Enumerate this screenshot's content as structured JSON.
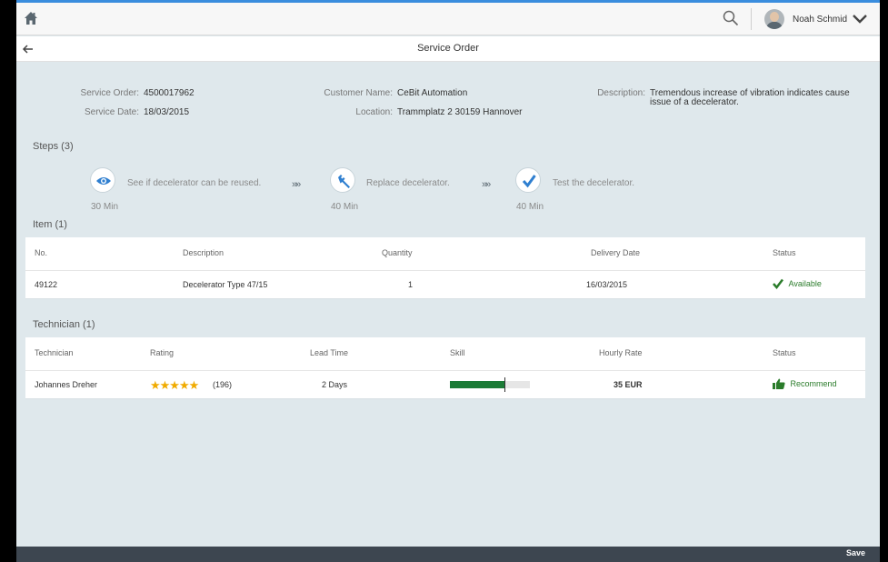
{
  "shell": {
    "user_name": "Noah Schmid"
  },
  "page": {
    "title": "Service Order"
  },
  "header": {
    "service_order_label": "Service Order:",
    "service_order_value": "4500017962",
    "service_date_label": "Service Date:",
    "service_date_value": "18/03/2015",
    "customer_name_label": "Customer Name:",
    "customer_name_value": "CeBit Automation",
    "location_label": "Location:",
    "location_value": "Trammplatz 2 30159 Hannover",
    "description_label": "Description:",
    "description_value_line1": "Tremendous increase of vibration indicates cause",
    "description_value_line2": "issue of a decelerator."
  },
  "steps": {
    "title": "Steps (3)",
    "items": [
      {
        "label": "See if decelerator can be reused.",
        "time": "30 Min",
        "icon": "eye-icon"
      },
      {
        "label": "Replace decelerator.",
        "time": "40 Min",
        "icon": "wrench-icon"
      },
      {
        "label": "Test the decelerator.",
        "time": "40 Min",
        "icon": "checkmark-icon"
      }
    ],
    "arrow": "»»"
  },
  "items_table": {
    "title": "Item (1)",
    "headers": [
      "No.",
      "Description",
      "Quantity",
      "Delivery Date",
      "Status"
    ],
    "rows": [
      {
        "no": "49122",
        "description": "Decelerator Type 47/15",
        "quantity": "1",
        "delivery_date": "16/03/2015",
        "status": "Available"
      }
    ]
  },
  "technician_table": {
    "title": "Technician (1)",
    "headers": [
      "Technician",
      "Rating",
      "Lead Time",
      "Skill",
      "Hourly Rate",
      "Status"
    ],
    "rows": [
      {
        "technician": "Johannes Dreher",
        "stars": "★★★★★",
        "rating_count": "(196)",
        "lead_time": "2 Days",
        "skill_level": 0.68,
        "skill_target": 0.68,
        "hourly_rate": "35 EUR",
        "status": "Recommend"
      }
    ]
  },
  "footer": {
    "save_label": "Save"
  },
  "colors": {
    "accent": "#3a8dde",
    "positive": "#2b7c2b",
    "skill_fill": "#1b7b36",
    "star": "#f0ab00",
    "footer_bg": "#3d4650"
  }
}
